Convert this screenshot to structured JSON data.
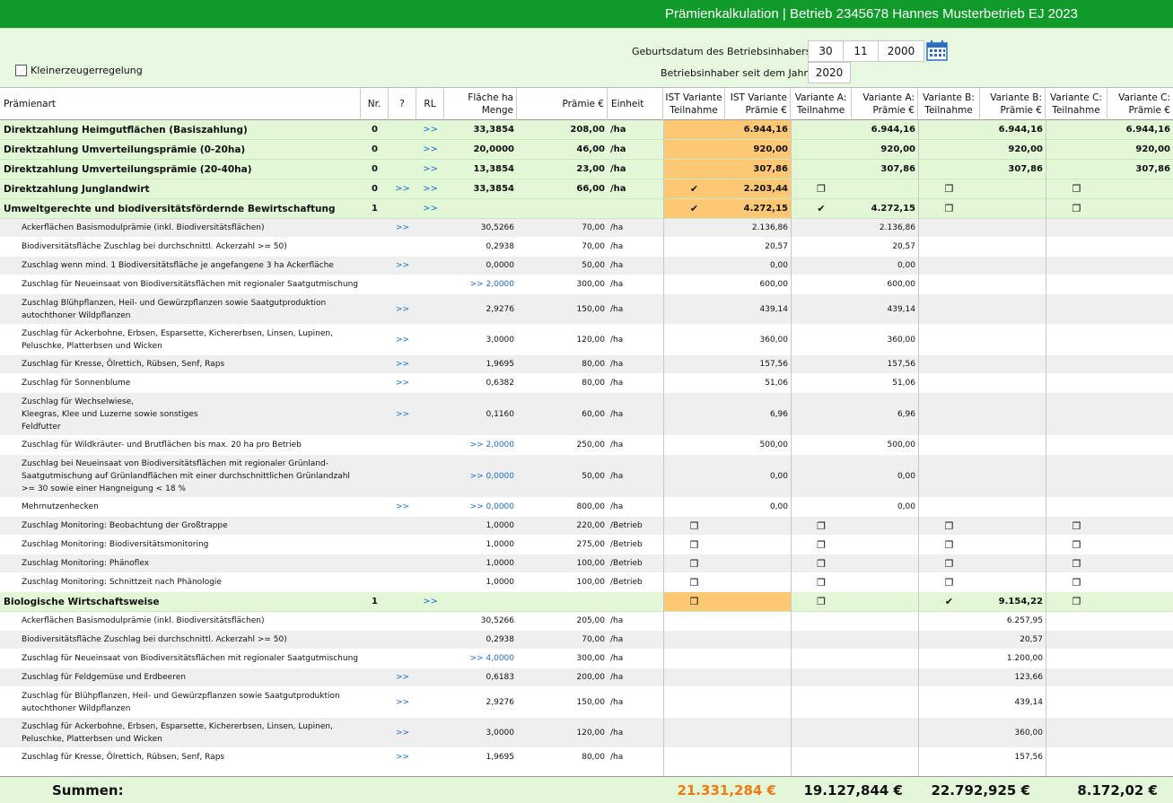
{
  "title": "Prämienkalkulation | Betrieb 2345678 Hannes Musterbetrieb EJ 2023",
  "form": {
    "kleinerzeuger_label": "Kleinerzeugerregelung",
    "geburtsdatum_label": "Geburtsdatum des Betriebsinhabers:",
    "geb_tag": "30",
    "geb_monat": "11",
    "geb_jahr": "2000",
    "inhaber_seit_label": "Betriebsinhaber seit dem Jahr:",
    "inhaber_seit": "2020",
    "calendar_icon": "calendar-icon"
  },
  "headers": {
    "praemienart": "Prämienart",
    "nr": "Nr.",
    "q": "?",
    "rl": "RL",
    "flaeche1": "Fläche ha",
    "flaeche2": "Menge",
    "praemie": "Prämie €",
    "einheit": "Einheit",
    "ist_teil1": "IST Variante",
    "ist_teil2": "Teilnahme",
    "ist_pr1": "IST Variante",
    "ist_pr2": "Prämie €",
    "a_teil1": "Variante A:",
    "a_teil2": "Teilnahme",
    "a_pr1": "Variante A:",
    "a_pr2": "Prämie €",
    "b_teil1": "Variante B:",
    "b_teil2": "Teilnahme",
    "b_pr1": "Variante B:",
    "b_pr2": "Prämie €",
    "c_teil1": "Variante C:",
    "c_teil2": "Teilnahme",
    "c_pr1": "Variante C:",
    "c_pr2": "Prämie €"
  },
  "rows": [
    {
      "t": "main",
      "h": 22,
      "name": "Direktzahlung Heimgutflächen (Basiszahlung)",
      "nr": "0",
      "q": "",
      "rl": ">>",
      "fl": "33,3854",
      "pr": "208,00",
      "ein": "/ha",
      "ist_t": "",
      "ist_p": "6.944,16",
      "a_t": "",
      "a_p": "6.944,16",
      "b_t": "",
      "b_p": "6.944,16",
      "c_t": "",
      "c_p": "6.944,16",
      "orange": true
    },
    {
      "t": "main",
      "h": 22,
      "name": "Direktzahlung Umverteilungsprämie (0-20ha)",
      "nr": "0",
      "q": "",
      "rl": ">>",
      "fl": "20,0000",
      "pr": "46,00",
      "ein": "/ha",
      "ist_t": "",
      "ist_p": "920,00",
      "a_t": "",
      "a_p": "920,00",
      "b_t": "",
      "b_p": "920,00",
      "c_t": "",
      "c_p": "920,00",
      "orange": true
    },
    {
      "t": "main",
      "h": 22,
      "name": "Direktzahlung Umverteilungsprämie (20-40ha)",
      "nr": "0",
      "q": "",
      "rl": ">>",
      "fl": "13,3854",
      "pr": "23,00",
      "ein": "/ha",
      "ist_t": "",
      "ist_p": "307,86",
      "a_t": "",
      "a_p": "307,86",
      "b_t": "",
      "b_p": "307,86",
      "c_t": "",
      "c_p": "307,86",
      "orange": true
    },
    {
      "t": "main",
      "h": 22,
      "name": "Direktzahlung Junglandwirt",
      "nr": "0",
      "q": ">>",
      "rl": ">>",
      "fl": "33,3854",
      "pr": "66,00",
      "ein": "/ha",
      "ist_t": "✔",
      "ist_p": "2.203,44",
      "a_t": "❐",
      "a_p": "",
      "b_t": "❐",
      "b_p": "",
      "c_t": "❐",
      "c_p": "",
      "orange": true
    },
    {
      "t": "main",
      "h": 22,
      "name": "Umweltgerechte und biodiversitätsfördernde Bewirtschaftung",
      "nr": "1",
      "q": "",
      "rl": ">>",
      "fl": "",
      "pr": "",
      "ein": "",
      "ist_t": "✔",
      "ist_p": "4.272,15",
      "a_t": "✔",
      "a_p": "4.272,15",
      "b_t": "❐",
      "b_p": "",
      "c_t": "❐",
      "c_p": "",
      "orange": true
    },
    {
      "t": "sub",
      "h": 21,
      "alt": true,
      "name": "Ackerflächen Basismodulprämie (inkl. Biodiversitätsflächen)",
      "q": ">>",
      "rl": "",
      "fl": "30,5266",
      "pr": "70,00",
      "ein": "/ha",
      "ist_p": "2.136,86",
      "a_p": "2.136,86"
    },
    {
      "t": "sub",
      "h": 21,
      "name": "Biodiversitätsfläche Zuschlag bei durchschnittl. Ackerzahl >= 50)",
      "q": "",
      "rl": "",
      "fl": "0,2938",
      "pr": "70,00",
      "ein": "/ha",
      "ist_p": "20,57",
      "a_p": "20,57"
    },
    {
      "t": "sub",
      "h": 21,
      "alt": true,
      "name": "Zuschlag wenn mind. 1 Biodiversitätsfläche je angefangene 3 ha Ackerfläche",
      "q": ">>",
      "rl": "",
      "fl": "0,0000",
      "pr": "50,00",
      "ein": "/ha",
      "ist_p": "0,00",
      "a_p": "0,00"
    },
    {
      "t": "sub",
      "h": 21,
      "name": "Zuschlag für Neueinsaat von Biodiversitätsflächen mit regionaler Saatgutmischung",
      "q": "",
      "rl": "",
      "flink": ">> 2,0000",
      "fl": "",
      "pr": "300,00",
      "ein": "/ha",
      "ist_p": "600,00",
      "a_p": "600,00"
    },
    {
      "t": "sub",
      "h": 34,
      "alt": true,
      "name": "Zuschlag Blühpflanzen, Heil- und Gewürzpflanzen sowie Saatgutproduktion autochthoner Wildpflanzen",
      "q": ">>",
      "rl": "",
      "fl": "2,9276",
      "pr": "150,00",
      "ein": "/ha",
      "ist_p": "439,14",
      "a_p": "439,14"
    },
    {
      "t": "sub",
      "h": 34,
      "name": "Zuschlag für Ackerbohne, Erbsen, Esparsette, Kichererbsen, Linsen, Lupinen, Peluschke, Platterbsen und Wicken",
      "q": ">>",
      "rl": "",
      "fl": "3,0000",
      "pr": "120,00",
      "ein": "/ha",
      "ist_p": "360,00",
      "a_p": "360,00"
    },
    {
      "t": "sub",
      "h": 21,
      "alt": true,
      "name": "Zuschlag für Kresse, Ölrettich, Rübsen, Senf, Raps",
      "q": ">>",
      "rl": "",
      "fl": "1,9695",
      "pr": "80,00",
      "ein": "/ha",
      "ist_p": "157,56",
      "a_p": "157,56"
    },
    {
      "t": "sub",
      "h": 21,
      "name": "Zuschlag für Sonnenblume",
      "q": ">>",
      "rl": "",
      "fl": "0,6382",
      "pr": "80,00",
      "ein": "/ha",
      "ist_p": "51,06",
      "a_p": "51,06"
    },
    {
      "t": "sub",
      "h": 48,
      "alt": true,
      "name": "Zuschlag für Wechselwiese,\nKleegras, Klee und Luzerne sowie sonstiges\nFeldfutter",
      "q": ">>",
      "rl": "",
      "fl": "0,1160",
      "pr": "60,00",
      "ein": "/ha",
      "ist_p": "6,96",
      "a_p": "6,96"
    },
    {
      "t": "sub",
      "h": 21,
      "name": "Zuschlag für Wildkräuter- und Brutflächen bis max. 20 ha pro Betrieb",
      "q": "",
      "rl": "",
      "flink": ">> 2,0000",
      "fl": "",
      "pr": "250,00",
      "ein": "/ha",
      "ist_p": "500,00",
      "a_p": "500,00"
    },
    {
      "t": "sub",
      "h": 48,
      "alt": true,
      "name": "Zuschlag bei Neueinsaat von Biodiversitätsflächen mit regionaler Grünland-Saatgutmischung auf Grünlandflächen mit einer durchschnittlichen Grünlandzahl >= 30 sowie einer Hangneigung < 18 %",
      "q": "",
      "rl": "",
      "flink": ">> 0,0000",
      "fl": "",
      "pr": "50,00",
      "ein": "/ha",
      "ist_p": "0,00",
      "a_p": "0,00"
    },
    {
      "t": "sub",
      "h": 21,
      "name": "Mehrnutzenhecken",
      "q": ">>",
      "rl": "",
      "flink": ">> 0,0000",
      "fl": "",
      "pr": "800,00",
      "ein": "/ha",
      "ist_p": "0,00",
      "a_p": "0,00"
    },
    {
      "t": "sub",
      "h": 21,
      "alt": true,
      "name": "Zuschlag Monitoring: Beobachtung der Großtrappe",
      "q": "",
      "rl": "",
      "fl": "1,0000",
      "pr": "220,00",
      "ein": "/Betrieb",
      "ist_t": "❐",
      "a_t": "❐",
      "b_t": "❐",
      "c_t": "❐"
    },
    {
      "t": "sub",
      "h": 21,
      "name": "Zuschlag Monitoring: Biodiversitätsmonitoring",
      "q": "",
      "rl": "",
      "fl": "1,0000",
      "pr": "275,00",
      "ein": "/Betrieb",
      "ist_t": "❐",
      "a_t": "❐",
      "b_t": "❐",
      "c_t": "❐"
    },
    {
      "t": "sub",
      "h": 21,
      "alt": true,
      "name": "Zuschlag Monitoring: Phänoflex",
      "q": "",
      "rl": "",
      "fl": "1,0000",
      "pr": "100,00",
      "ein": "/Betrieb",
      "ist_t": "❐",
      "a_t": "❐",
      "b_t": "❐",
      "c_t": "❐"
    },
    {
      "t": "sub",
      "h": 21,
      "name": "Zuschlag Monitoring: Schnittzeit nach Phänologie",
      "q": "",
      "rl": "",
      "fl": "1,0000",
      "pr": "100,00",
      "ein": "/Betrieb",
      "ist_t": "❐",
      "a_t": "❐",
      "b_t": "❐",
      "c_t": "❐"
    },
    {
      "t": "main",
      "h": 22,
      "name": "Biologische Wirtschaftsweise",
      "nr": "1",
      "q": "",
      "rl": ">>",
      "fl": "",
      "pr": "",
      "ein": "",
      "ist_t": "❐",
      "ist_p": "",
      "a_t": "❐",
      "a_p": "",
      "b_t": "✔",
      "b_p": "9.154,22",
      "c_t": "❐",
      "c_p": "",
      "orange": true
    },
    {
      "t": "sub",
      "h": 21,
      "name": "Ackerflächen Basismodulprämie (inkl. Biodiversitätsflächen)",
      "q": "",
      "rl": "",
      "fl": "30,5266",
      "pr": "205,00",
      "ein": "/ha",
      "b_p": "6.257,95"
    },
    {
      "t": "sub",
      "h": 21,
      "alt": true,
      "name": "Biodiversitätsfläche Zuschlag bei durchschnittl. Ackerzahl >= 50)",
      "q": "",
      "rl": "",
      "fl": "0,2938",
      "pr": "70,00",
      "ein": "/ha",
      "b_p": "20,57"
    },
    {
      "t": "sub",
      "h": 21,
      "name": "Zuschlag für Neueinsaat von Biodiversitätsflächen mit regionaler Saatgutmischung",
      "q": "",
      "rl": "",
      "flink": ">> 4,0000",
      "fl": "",
      "pr": "300,00",
      "ein": "/ha",
      "b_p": "1.200,00"
    },
    {
      "t": "sub",
      "h": 21,
      "alt": true,
      "name": "Zuschlag für Feldgemüse und Erdbeeren",
      "q": ">>",
      "rl": "",
      "fl": "0,6183",
      "pr": "200,00",
      "ein": "/ha",
      "b_p": "123,66"
    },
    {
      "t": "sub",
      "h": 34,
      "name": "Zuschlag für Blühpflanzen, Heil- und Gewürzpflanzen sowie Saatgutproduktion autochthoner Wildpflanzen",
      "q": ">>",
      "rl": "",
      "fl": "2,9276",
      "pr": "150,00",
      "ein": "/ha",
      "b_p": "439,14"
    },
    {
      "t": "sub",
      "h": 34,
      "alt": true,
      "name": "Zuschlag für Ackerbohne, Erbsen, Esparsette, Kichererbsen, Linsen, Lupinen, Peluschke, Platterbsen und Wicken",
      "q": ">>",
      "rl": "",
      "fl": "3,0000",
      "pr": "120,00",
      "ein": "/ha",
      "b_p": "360,00"
    },
    {
      "t": "sub",
      "h": 21,
      "name": "Zuschlag für Kresse, Ölrettich, Rübsen, Senf, Raps",
      "q": ">>",
      "rl": "",
      "fl": "1,9695",
      "pr": "80,00",
      "ein": "/ha",
      "b_p": "157,56"
    }
  ],
  "summen": {
    "label": "Summen:",
    "ist": "21.331,284 €",
    "a": "19.127,844 €",
    "b": "22.792,925 €",
    "c": "8.172,02 €",
    "ist_color": "#f07a10"
  }
}
